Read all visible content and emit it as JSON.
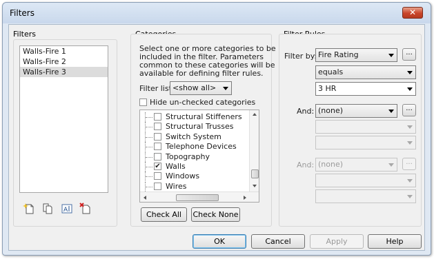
{
  "dialog": {
    "title": "Filters",
    "close_glyph": "✕"
  },
  "filters": {
    "label": "Filters",
    "items": [
      "Walls-Fire 1",
      "Walls-Fire 2",
      "Walls-Fire 3"
    ],
    "selected_index": 2,
    "toolbar_icons": [
      "new-filter-icon",
      "duplicate-filter-icon",
      "rename-filter-icon",
      "delete-filter-icon"
    ]
  },
  "categories": {
    "label": "Categories",
    "description_lines": [
      "Select one or more categories to be",
      "included in the filter.  Parameters",
      "common to these categories will be",
      "available for defining filter rules."
    ],
    "filter_list_label": "Filter list:",
    "filter_list_value": "<show all>",
    "hide_unchecked_label": "Hide un-checked categories",
    "hide_unchecked_checked": false,
    "items": [
      {
        "label": "Structural Stiffeners",
        "checked": false
      },
      {
        "label": "Structural Trusses",
        "checked": false
      },
      {
        "label": "Switch System",
        "checked": false
      },
      {
        "label": "Telephone Devices",
        "checked": false
      },
      {
        "label": "Topography",
        "checked": false
      },
      {
        "label": "Walls",
        "checked": true
      },
      {
        "label": "Windows",
        "checked": false
      },
      {
        "label": "Wires",
        "checked": false
      }
    ],
    "check_all_label": "Check All",
    "check_none_label": "Check None"
  },
  "rules": {
    "label": "Filter Rules",
    "filter_by_label": "Filter by:",
    "filter_by_param": "Fire Rating",
    "operator": "equals",
    "value": "3 HR",
    "and1_label": "And:",
    "and1_param": "(none)",
    "and2_label": "And:",
    "and2_param": "(none)",
    "ellipsis_label": "..."
  },
  "buttons": {
    "ok": "OK",
    "cancel": "Cancel",
    "apply": "Apply",
    "help": "Help"
  },
  "colors": {
    "selection_gray": "#dcdcdc",
    "window_frame": "#dfe8f3",
    "close_red": "#c9452a"
  }
}
